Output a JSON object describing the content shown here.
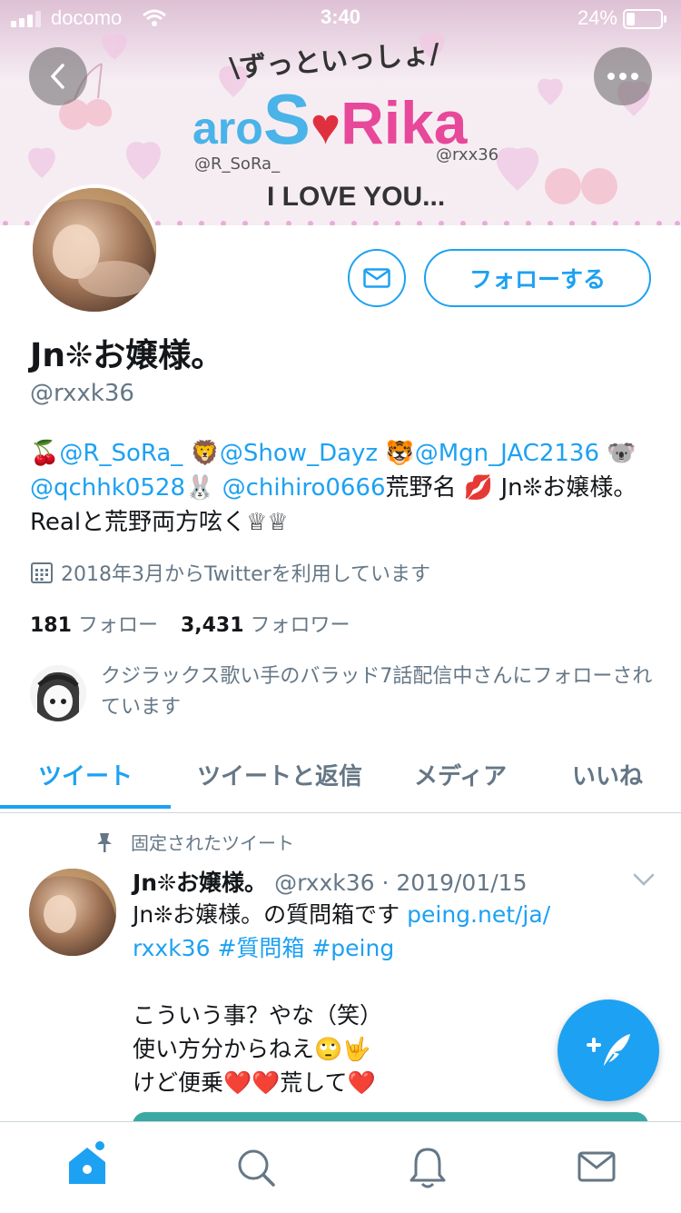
{
  "status_bar": {
    "carrier": "docomo",
    "time": "3:40",
    "battery": "24%"
  },
  "banner": {
    "top_text": "\\ずっといっしょ/",
    "logo_left": "aro",
    "logo_s": "S",
    "logo_right": "Rika",
    "tag_left": "@R_SoRa_",
    "tag_right": "@rxx36",
    "bottom_text": "I LOVE YOU..."
  },
  "profile": {
    "name": "Jn❊お嬢様。",
    "handle": "@rxxk36",
    "follow_label": "フォローする",
    "bio": {
      "line1_parts": [
        "🍒",
        "@R_SoRa_",
        "🦁",
        "@Show_Dayz",
        "🐯",
        "@Mgn_JAC2136",
        "🐨"
      ],
      "line2_parts": [
        "@qchhk0528",
        "🐰",
        "@chihiro0666",
        "荒野名",
        "💋",
        "Jn❊お嬢様。"
      ],
      "line3": "Realと荒野両方呟く♕♕"
    },
    "joined": "2018年3月からTwitterを利用しています",
    "following_count": "181",
    "following_label": "フォロー",
    "followers_count": "3,431",
    "followers_label": "フォロワー",
    "followed_by": "クジラックス歌い手のバラッド7話配信中さんにフォローされています"
  },
  "tabs": [
    {
      "label": "ツイート"
    },
    {
      "label": "ツイートと返信"
    },
    {
      "label": "メディア"
    },
    {
      "label": "いいね"
    }
  ],
  "tweet": {
    "pinned_label": "固定されたツイート",
    "author": "Jn❊お嬢様。",
    "meta": "@rxxk36 · 2019/01/15",
    "line1_text": "Jn❊お嬢様。の質問箱です ",
    "line1_link": "peing.net/ja/",
    "line2_link": "rxxk36",
    "line2_tag1": "#質問箱",
    "line2_tag2": "#peing",
    "line3": "こういう事？やな（笑）",
    "line4": "使い方分からねえ🙄🤟",
    "line5_a": "けど便乗",
    "line5_hearts": "❤️❤️",
    "line5_b": "荒して",
    "line5_heart": "❤️"
  },
  "colors": {
    "accent": "#1da1f2",
    "muted": "#657786",
    "text": "#14171a"
  }
}
